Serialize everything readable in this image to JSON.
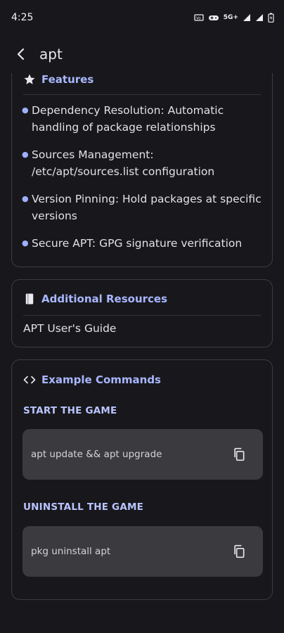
{
  "status_bar": {
    "time": "4:25",
    "network_label": "5G+",
    "icons": [
      "volte-icon",
      "gamepad-icon",
      "signal-icon",
      "signal-icon",
      "battery-icon"
    ]
  },
  "app_bar": {
    "title": "apt",
    "back_icon": "back-arrow-icon"
  },
  "features": {
    "heading": "Features",
    "icon": "star-icon",
    "items": [
      "Dependency Resolution: Automatic handling of package relationships",
      "Sources Management: /etc/apt/sources.list configuration",
      "Version Pinning: Hold packages at specific versions",
      "Secure APT: GPG signature verification"
    ]
  },
  "resources": {
    "heading": "Additional Resources",
    "icon": "book-icon",
    "items": [
      "APT User's Guide"
    ]
  },
  "examples": {
    "heading": "Example Commands",
    "icon": "code-icon",
    "sections": [
      {
        "label": "START THE GAME",
        "command": "apt update && apt upgrade"
      },
      {
        "label": "UNINSTALL THE GAME",
        "command": "pkg uninstall apt"
      }
    ]
  },
  "colors": {
    "background": "#18181c",
    "accent": "#a9b6ff",
    "card_border": "#3b3b42",
    "code_box": "#3a3a3f"
  }
}
